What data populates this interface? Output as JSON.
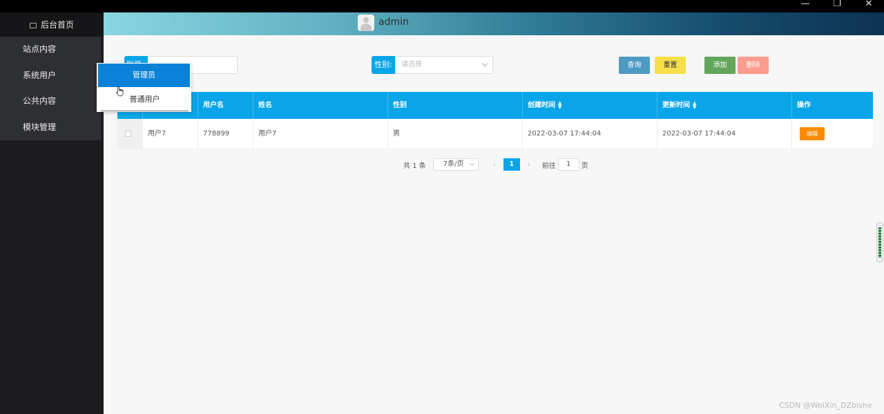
{
  "window": {
    "minimize_glyph": "—",
    "restore_glyph": "❐",
    "close_glyph": "✕"
  },
  "sidebar": {
    "home": "后台首页",
    "items": [
      {
        "label": "站点内容"
      },
      {
        "label": "系统用户"
      },
      {
        "label": "公共内容"
      },
      {
        "label": "模块管理"
      }
    ]
  },
  "header": {
    "username": "admin"
  },
  "filters": {
    "search_label": "账号",
    "gender_label": "性别:",
    "gender_placeholder": "请选择"
  },
  "buttons": {
    "query": "查询",
    "reset": "重置",
    "add": "添加",
    "delete": "删除"
  },
  "table": {
    "columns": [
      "",
      "用户名",
      "姓名",
      "性别",
      "创建时间",
      "更新时间",
      "操作"
    ],
    "rows": [
      {
        "account": "用户7",
        "username": "778899",
        "name": "用户7",
        "gender": "男",
        "created": "2022-03-07 17:44:04",
        "updated": "2022-03-07 17:44:04",
        "action": "编辑"
      }
    ]
  },
  "pagination": {
    "total": "共 1 条",
    "page_size": "7条/页",
    "prev": "‹",
    "current": "1",
    "next": "›",
    "goto_label": "前往",
    "goto_value": "1",
    "page_suffix": "页"
  },
  "submenu": {
    "items": [
      "管理员",
      "普通用户"
    ]
  },
  "watermark": "CSDN @WeiXin_DZbishe",
  "colors": {
    "accent": "#0aa5e8",
    "submenu_active": "#0b82d8",
    "edit": "#fb8c00",
    "query": "#4f9ac3",
    "reset": "#f7df4a",
    "add": "#63a55a",
    "delete": "#fb9c8e"
  }
}
